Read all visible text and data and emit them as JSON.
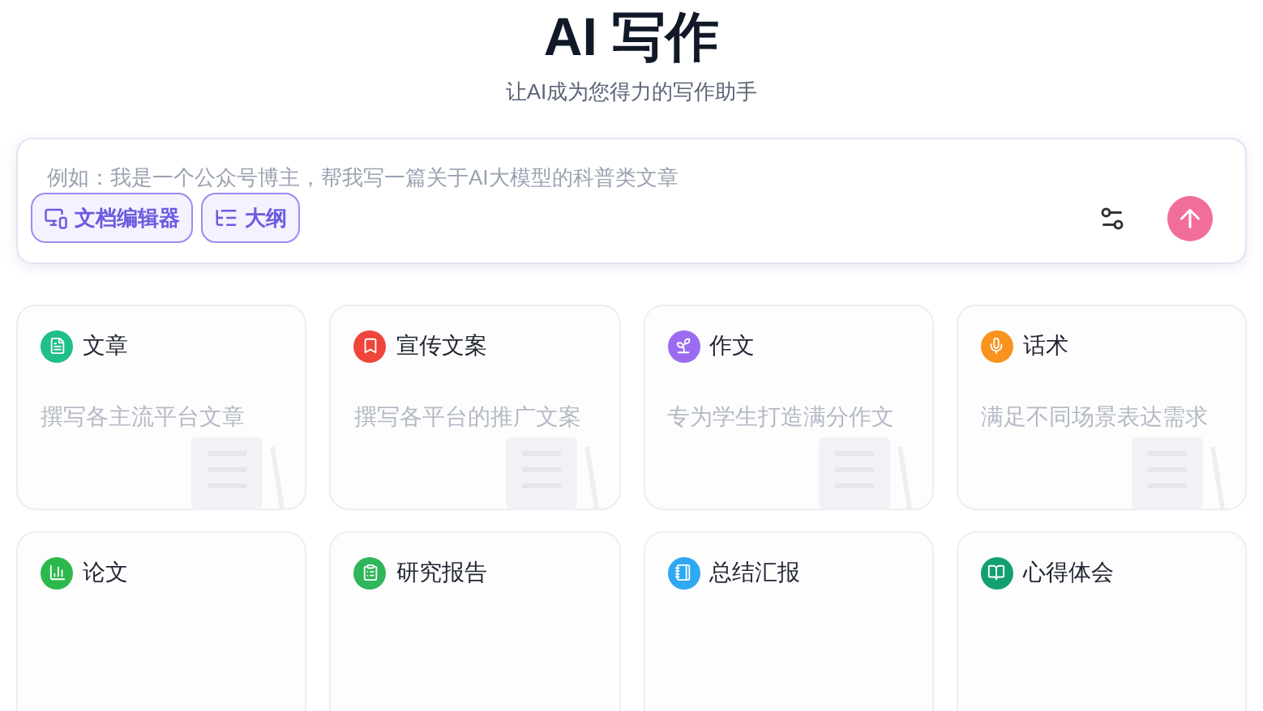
{
  "header": {
    "title": "AI 写作",
    "subtitle": "让AI成为您得力的写作助手"
  },
  "composer": {
    "placeholder": "例如：我是一个公众号博主，帮我写一篇关于AI大模型的科普类文章",
    "tools": [
      {
        "label": "文档编辑器"
      },
      {
        "label": "大纲"
      }
    ]
  },
  "cards": [
    {
      "title": "文章",
      "description": "撰写各主流平台文章",
      "color": "#1fbf8a"
    },
    {
      "title": "宣传文案",
      "description": "撰写各平台的推广文案",
      "color": "#f0453a"
    },
    {
      "title": "作文",
      "description": "专为学生打造满分作文",
      "color": "#9b6cf0"
    },
    {
      "title": "话术",
      "description": "满足不同场景表达需求",
      "color": "#f7931e"
    },
    {
      "title": "论文",
      "color": "#2db84c"
    },
    {
      "title": "研究报告",
      "color": "#2fb55a"
    },
    {
      "title": "总结汇报",
      "color": "#2ea8f0"
    },
    {
      "title": "心得体会",
      "color": "#14a06e"
    }
  ]
}
